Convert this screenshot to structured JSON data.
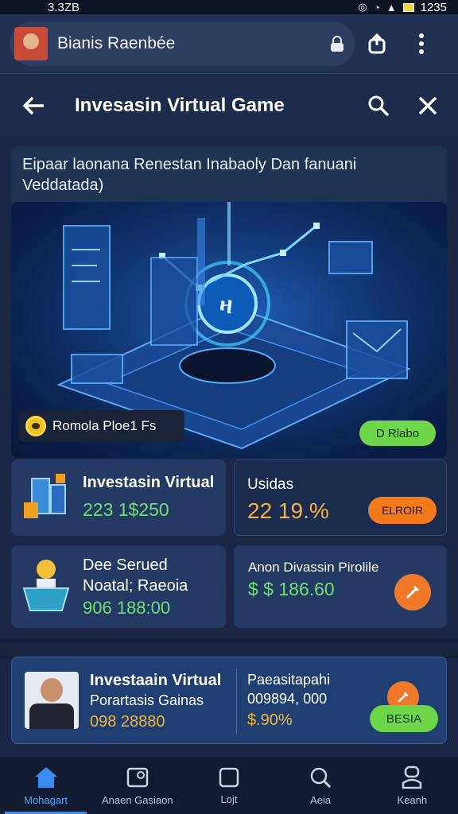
{
  "status_bar": {
    "time_left": "3.3ZB",
    "time_right": "1235",
    "battery_color": "#f2d33b"
  },
  "browser": {
    "url_text": "Bianis Raenbée"
  },
  "header": {
    "title": "Invesasin Virtual Game"
  },
  "intro": {
    "text": "Eipaar laonana Renestan Inabaoly Dan fanuani Veddatada)"
  },
  "hero": {
    "chip_label": "Romola Ploe1  Fs",
    "button_label": "D Rlabo"
  },
  "card1": {
    "title": "Investasin Virtual",
    "value": "223 1$250"
  },
  "card2": {
    "title": "Usidas",
    "value": "22 19.%",
    "button_label": "ELROIR"
  },
  "card3": {
    "title_line1": "Dee Serued",
    "title_line2": "Noatal; Raeoia",
    "value": "906 188:00"
  },
  "card4": {
    "title": "Anon Divassin Pirolile",
    "value": "$ $ 186.60"
  },
  "promo": {
    "title": "Investaain Virtual",
    "subtitle": "Porartasis Gainas",
    "value": "098 28880",
    "right_title": "Paeasitapahi",
    "right_value": "009894, 000",
    "right_percent": "$.90%",
    "button_label": "BESIA"
  },
  "nav": [
    {
      "label": "Mohagart",
      "icon": "home-icon"
    },
    {
      "label": "Anaen Gasiaon",
      "icon": "wallet-icon"
    },
    {
      "label": "Lojt",
      "icon": "square-icon"
    },
    {
      "label": "Aeia",
      "icon": "search-icon"
    },
    {
      "label": "Keanh",
      "icon": "profile-icon"
    }
  ],
  "colors": {
    "accent_green": "#6fd64a",
    "accent_orange": "#f47a1c",
    "value_green": "#6ee06e",
    "value_gold": "#f5b437",
    "nav_active": "#4aa3ff"
  }
}
